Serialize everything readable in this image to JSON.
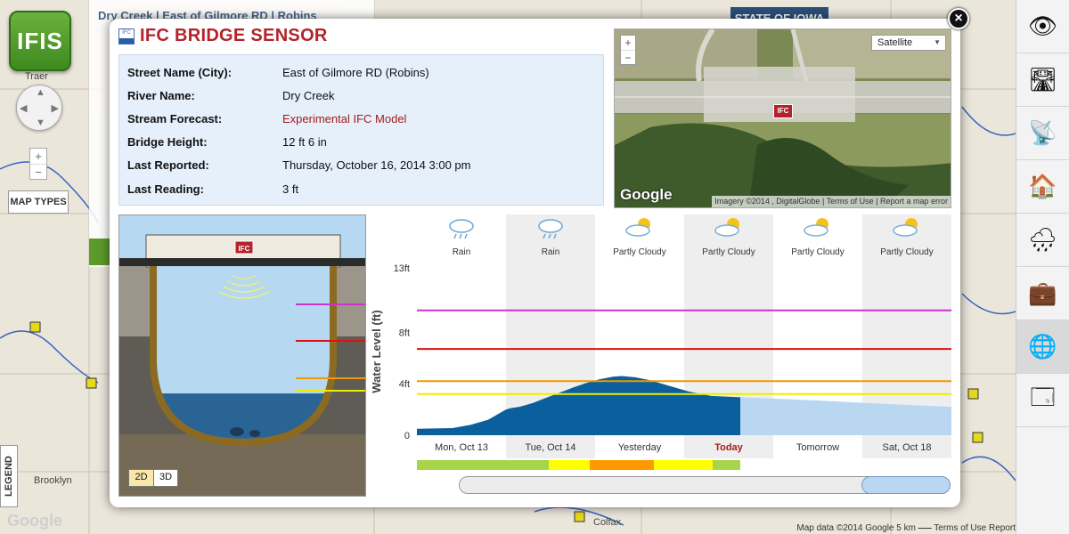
{
  "app": {
    "logo": "IFIS"
  },
  "map": {
    "map_types_label": "MAP TYPES",
    "legend_label": "LEGEND",
    "zoom_in": "+",
    "zoom_out": "−",
    "google_label": "Google",
    "attribution": "Map data ©2014 Google   5 km ⎯⎯⎯   Terms of Use   Report",
    "state_banner": "STATE OF IOWA",
    "places": [
      {
        "label": "Traer"
      },
      {
        "label": "Brooklyn"
      },
      {
        "label": "Colfax"
      }
    ],
    "background_card_title": "Dry Creek | East of Gilmore RD | Robins"
  },
  "sidebar": {
    "items": [
      {
        "icon": "eye-icon",
        "glyph": "👁"
      },
      {
        "icon": "road-icon",
        "glyph": "🛣"
      },
      {
        "icon": "satellite-dish-icon",
        "glyph": "📡"
      },
      {
        "icon": "flood-house-icon",
        "glyph": "🏠"
      },
      {
        "icon": "rain-cloud-icon",
        "glyph": "🌧"
      },
      {
        "icon": "briefcase-icon",
        "glyph": "💼"
      },
      {
        "icon": "globe-icon",
        "glyph": "🌐"
      },
      {
        "icon": "window-cursor-icon",
        "glyph": "🗔"
      }
    ]
  },
  "modal": {
    "title": "IFC BRIDGE SENSOR",
    "badge": "IFC",
    "close": "×",
    "info": [
      {
        "key": "Street Name (City):",
        "value": "East of Gilmore RD (Robins)"
      },
      {
        "key": "River Name:",
        "value": "Dry Creek"
      },
      {
        "key": "Stream Forecast:",
        "value": "Experimental IFC Model",
        "link": true
      },
      {
        "key": "Bridge Height:",
        "value": "12 ft 6 in"
      },
      {
        "key": "Last Reported:",
        "value": "Thursday, October 16, 2014 3:00 pm"
      },
      {
        "key": "Last Reading:",
        "value": "3 ft"
      }
    ],
    "satellite": {
      "zoom_in": "+",
      "zoom_out": "−",
      "map_type": "Satellite",
      "google_label": "Google",
      "attribution": "Imagery ©2014 , DigitalGlobe | Terms of Use | Report a map error",
      "marker": "IFC"
    },
    "diagram": {
      "marker": "IFC",
      "view_2d": "2D",
      "view_3d": "3D",
      "selected_view": "2D"
    }
  },
  "chart_data": {
    "type": "area",
    "ylabel": "Water Level (ft)",
    "ylim": [
      0,
      13
    ],
    "yticks": [
      "0",
      "4ft",
      "8ft",
      "13ft"
    ],
    "ytick_values": [
      0,
      4,
      8,
      13
    ],
    "days": [
      {
        "label": "Mon, Oct 13",
        "weather": "Rain",
        "icon": "rain-cloud-icon",
        "shaded": false,
        "today": false
      },
      {
        "label": "Tue, Oct 14",
        "weather": "Rain",
        "icon": "rain-cloud-icon",
        "shaded": true,
        "today": false
      },
      {
        "label": "Yesterday",
        "weather": "Partly Cloudy",
        "icon": "partly-cloudy-icon",
        "shaded": false,
        "today": false
      },
      {
        "label": "Today",
        "weather": "Partly Cloudy",
        "icon": "partly-cloudy-icon",
        "shaded": true,
        "today": true
      },
      {
        "label": "Tomorrow",
        "weather": "Partly Cloudy",
        "icon": "partly-cloudy-icon",
        "shaded": false,
        "today": false
      },
      {
        "label": "Sat, Oct 18",
        "weather": "Partly Cloudy",
        "icon": "partly-cloudy-icon",
        "shaded": true,
        "today": false
      }
    ],
    "thresholds": [
      {
        "value": 9.7,
        "color": "#cc33cc"
      },
      {
        "value": 6.7,
        "color": "#dd1111"
      },
      {
        "value": 4.2,
        "color": "#ee9900"
      },
      {
        "value": 3.2,
        "color": "#eeee00"
      }
    ],
    "observed": {
      "color": "#0a5f9c",
      "points": [
        [
          0.0,
          0.5
        ],
        [
          0.4,
          0.55
        ],
        [
          0.6,
          0.8
        ],
        [
          0.8,
          1.2
        ],
        [
          0.9,
          1.6
        ],
        [
          1.0,
          2.0
        ],
        [
          1.05,
          2.1
        ],
        [
          1.15,
          2.2
        ],
        [
          1.3,
          2.5
        ],
        [
          1.45,
          2.9
        ],
        [
          1.6,
          3.3
        ],
        [
          1.75,
          3.7
        ],
        [
          1.9,
          4.05
        ],
        [
          2.05,
          4.35
        ],
        [
          2.2,
          4.55
        ],
        [
          2.3,
          4.6
        ],
        [
          2.45,
          4.5
        ],
        [
          2.6,
          4.3
        ],
        [
          2.75,
          4.0
        ],
        [
          2.9,
          3.7
        ],
        [
          3.05,
          3.4
        ],
        [
          3.2,
          3.2
        ],
        [
          3.3,
          3.05
        ],
        [
          3.63,
          2.95
        ]
      ]
    },
    "forecast": {
      "color": "#b9d7f1",
      "points": [
        [
          3.63,
          2.95
        ],
        [
          4.5,
          2.7
        ],
        [
          5.5,
          2.35
        ],
        [
          6.0,
          2.2
        ]
      ]
    },
    "risk_bar": [
      {
        "from": 0.0,
        "to": 1.48,
        "color": "#a8d44a"
      },
      {
        "from": 1.48,
        "to": 1.94,
        "color": "#ffff00"
      },
      {
        "from": 1.94,
        "to": 2.66,
        "color": "#ff9900"
      },
      {
        "from": 2.66,
        "to": 3.32,
        "color": "#ffff00"
      },
      {
        "from": 3.32,
        "to": 3.63,
        "color": "#a8d44a"
      }
    ]
  }
}
